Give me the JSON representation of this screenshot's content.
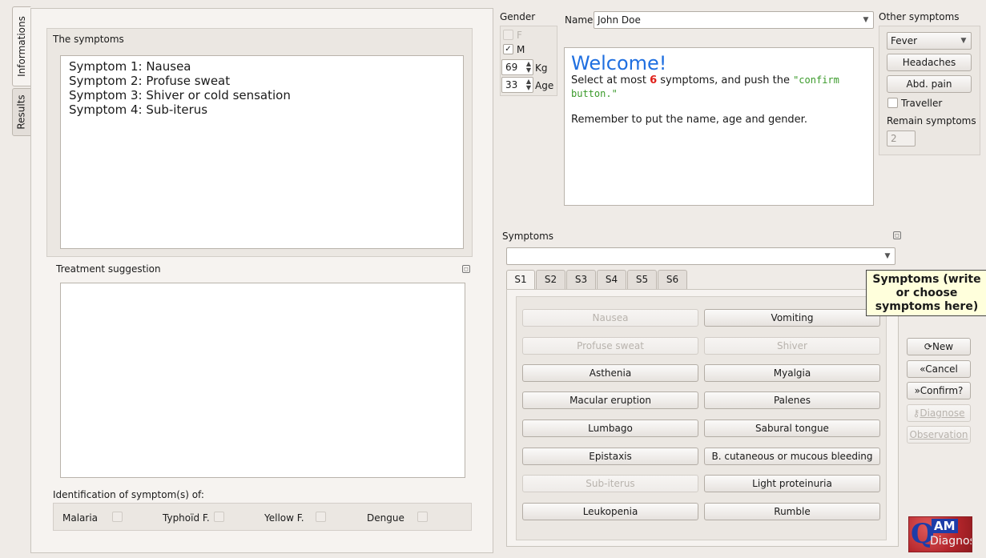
{
  "tabs": {
    "informations": "Informations",
    "results": "Results"
  },
  "symptoms_box": {
    "title": "The symptoms",
    "lines": [
      "Symptom 1: Nausea",
      "Symptom 2: Profuse sweat",
      "Symptom 3: Shiver or cold sensation",
      "Symptom 4: Sub-iterus"
    ]
  },
  "treatment": {
    "title": "Treatment suggestion"
  },
  "identification": {
    "title": "Identification of symptom(s) of:",
    "diseases": [
      "Malaria",
      "Typhoïd F.",
      "Yellow F.",
      "Dengue"
    ]
  },
  "gender": {
    "title": "Gender",
    "female": "F",
    "male": "M",
    "male_checked": "✓",
    "weight_value": "69",
    "weight_unit": "Kg",
    "age_value": "33",
    "age_unit": "Age"
  },
  "name": {
    "label": "Name",
    "value": "John Doe"
  },
  "welcome": {
    "title": "Welcome!",
    "line1_a": "Select at most ",
    "line1_num": "6",
    "line1_b": " symptoms, and push the ",
    "line1_code": "\"confirm button.\"",
    "line2": "Remember to put the name, age and gender."
  },
  "other_symptoms": {
    "title": "Other symptoms",
    "selected": "Fever",
    "headaches": "Headaches",
    "abd_pain": "Abd. pain",
    "traveller": "Traveller",
    "remain_label": "Remain symptoms",
    "remain_value": "2"
  },
  "symptoms_panel": {
    "title": "Symptoms",
    "tabs": [
      "S1",
      "S2",
      "S3",
      "S4",
      "S5",
      "S6"
    ],
    "tooltip": "Symptoms (write or choose symptoms here)",
    "buttons": [
      "Nausea",
      "Vomiting",
      "Profuse sweat",
      "Shiver",
      "Asthenia",
      "Myalgia",
      "Macular eruption",
      "Palenes",
      "Lumbago",
      "Sabural tongue",
      "Epistaxis",
      "B. cutaneous or mucous bleeding",
      "Sub-iterus",
      "Light proteinuria",
      "Leukopenia",
      "Rumble"
    ]
  },
  "actions": {
    "new": "New",
    "cancel": "Cancel",
    "confirm": "Confirm?",
    "diagnose": "Diagnose",
    "observation": "Observation"
  },
  "logo": {
    "am": "AM",
    "diagnos": "Diagnos"
  }
}
